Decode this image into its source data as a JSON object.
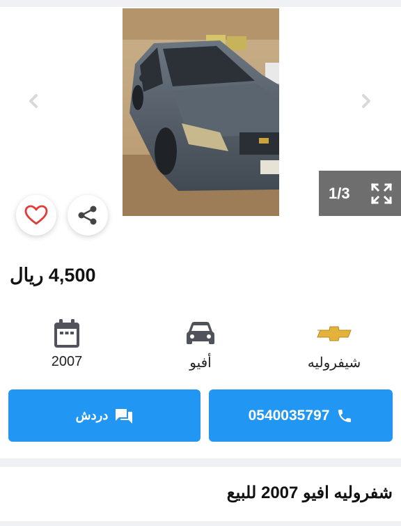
{
  "gallery": {
    "counter": "1/3",
    "photo_alt": "Chevrolet Aveo",
    "colors": {
      "counter_bg": "#6e6e6e"
    }
  },
  "listing": {
    "price": "4,500 ريال",
    "title": "شفروليه افيو 2007 للبيع"
  },
  "specs": {
    "year": "2007",
    "model": "أفيو",
    "make": "شيفروليه"
  },
  "actions": {
    "call_label": "0540035797",
    "chat_label": "دردش"
  },
  "icons": {
    "prev": "chevron-left-icon",
    "next": "chevron-right-icon",
    "fullscreen": "fullscreen-icon",
    "favorite": "heart-icon",
    "share": "share-icon",
    "calendar": "calendar-icon",
    "car": "car-icon",
    "brand": "chevrolet-logo-icon",
    "phone": "phone-icon",
    "chat": "chat-icon"
  },
  "colors": {
    "primary": "#2196f3",
    "heart": "#e53935",
    "icon_gray": "#505359",
    "brand_gold": "#e2b23a",
    "divider": "#eff1f5"
  }
}
